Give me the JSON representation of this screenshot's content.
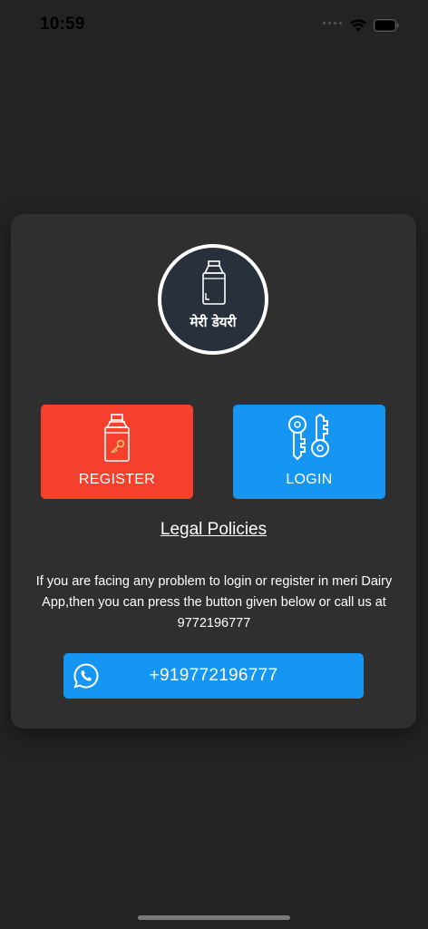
{
  "status_bar": {
    "time": "10:59",
    "icons": [
      "signal-dots-icon",
      "wifi-icon",
      "battery-icon"
    ]
  },
  "logo": {
    "icon": "milk-can-icon",
    "text": "मेरी डेयरी"
  },
  "register_button": {
    "label": "REGISTER",
    "icon": "milk-can-key-icon",
    "color": "#f4402d"
  },
  "login_button": {
    "label": "LOGIN",
    "icon": "keys-icon",
    "color": "#1596f2"
  },
  "legal_link": "Legal Policies",
  "help_text": "If you are facing any problem to login or register in meri Dairy App,then you can press the button given below  or call us  at 9772196777",
  "whatsapp_button": {
    "label": "+919772196777",
    "icon": "whatsapp-icon"
  },
  "colors": {
    "background": "#232323",
    "card": "#2f2f2f",
    "accent_blue": "#1596f2",
    "accent_red": "#f4402d"
  }
}
